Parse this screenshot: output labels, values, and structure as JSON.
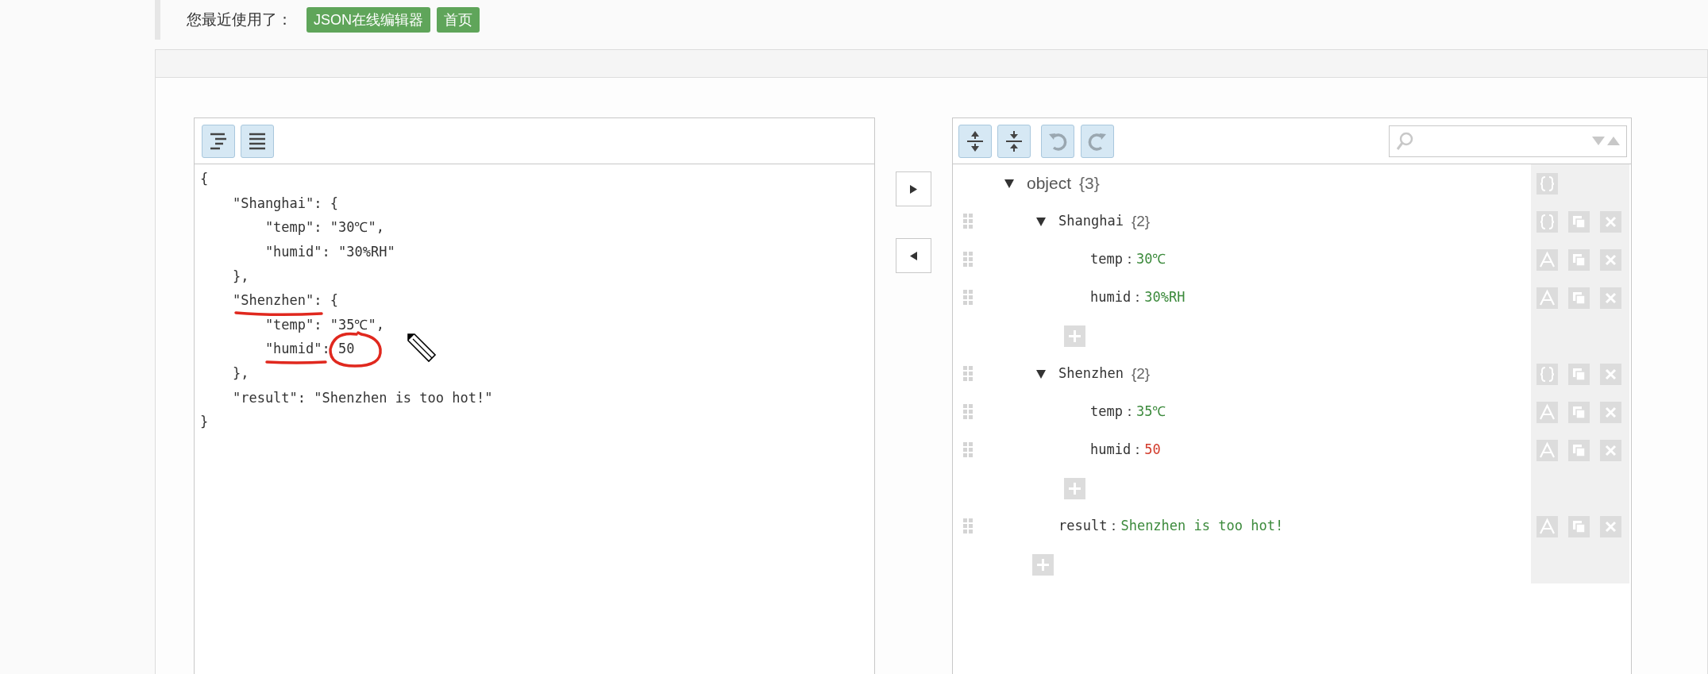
{
  "recent": {
    "label": "您最近使用了：",
    "links": [
      "JSON在线编辑器",
      "首页"
    ]
  },
  "code_editor": {
    "lines": [
      "{",
      "    \"Shanghai\": {",
      "        \"temp\": \"30℃\",",
      "        \"humid\": \"30%RH\"",
      "    },",
      "    \"Shenzhen\": {",
      "        \"temp\": \"35℃\",",
      "        \"humid\": 50",
      "    },",
      "    \"result\": \"Shenzhen is too hot!\"",
      "}"
    ]
  },
  "tree": {
    "root": {
      "key": "object",
      "count": "{3}",
      "expanded": true,
      "children": [
        {
          "kind": "object",
          "key": "Shanghai",
          "count": "{2}",
          "expanded": true,
          "children": [
            {
              "kind": "value",
              "key": "temp",
              "separator": "：",
              "value": "30℃",
              "color": "#3c8a3c"
            },
            {
              "kind": "value",
              "key": "humid",
              "separator": "：",
              "value": "30%RH",
              "color": "#3c8a3c"
            }
          ]
        },
        {
          "kind": "object",
          "key": "Shenzhen",
          "count": "{2}",
          "expanded": true,
          "children": [
            {
              "kind": "value",
              "key": "temp",
              "separator": "：",
              "value": "35℃",
              "color": "#3c8a3c"
            },
            {
              "kind": "value",
              "key": "humid",
              "separator": "：",
              "value": "50",
              "color": "#d23a2a"
            }
          ]
        },
        {
          "kind": "value",
          "key": "result",
          "separator": "：",
          "value": "Shenzhen is too hot!",
          "color": "#3c8a3c"
        }
      ]
    }
  }
}
